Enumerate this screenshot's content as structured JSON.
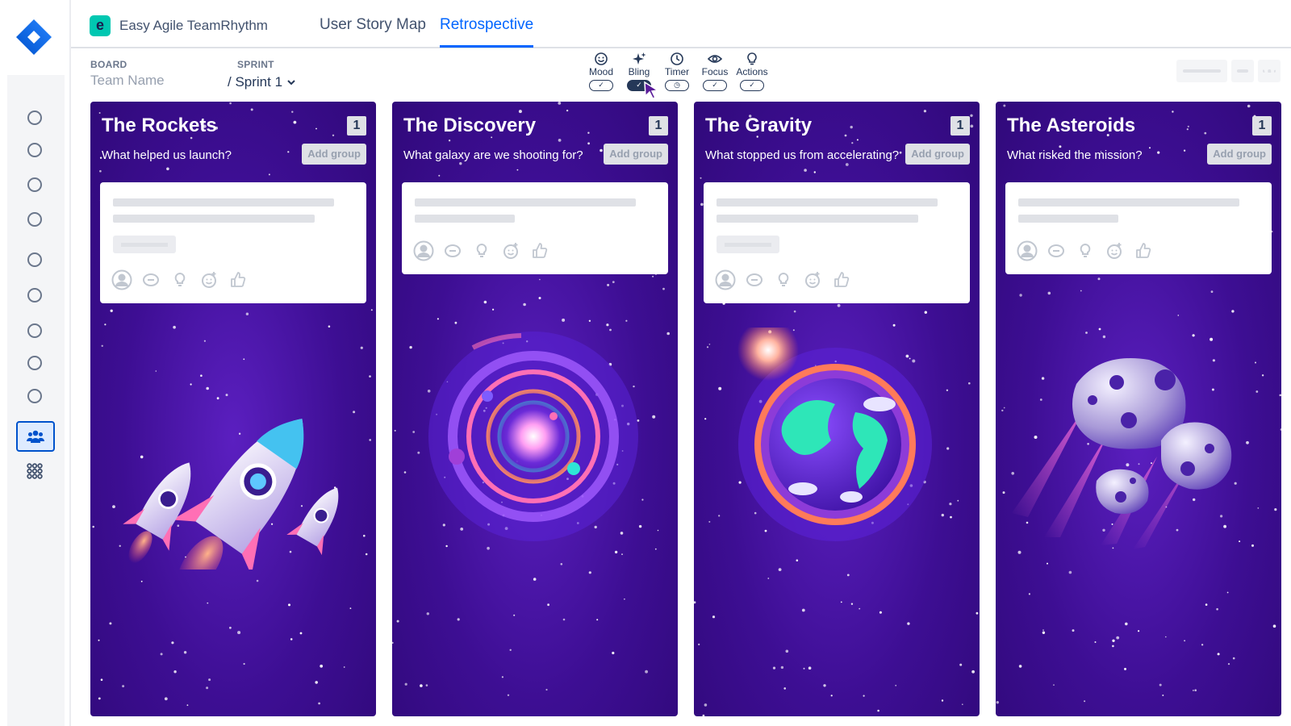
{
  "header": {
    "brand": "Easy Agile TeamRhythm",
    "brand_icon": "e",
    "tabs": [
      {
        "label": "User Story Map",
        "active": false
      },
      {
        "label": "Retrospective",
        "active": true
      }
    ]
  },
  "board": {
    "board_label": "BOARD",
    "board_value": "Team Name",
    "sprint_label": "SPRINT",
    "sprint_value": "/ Sprint 1"
  },
  "tools": [
    {
      "label": "Mood",
      "icon": "smiley-icon",
      "enabled": false
    },
    {
      "label": "Bling",
      "icon": "sparkle-icon",
      "enabled": true
    },
    {
      "label": "Timer",
      "icon": "clock-icon",
      "enabled": false
    },
    {
      "label": "Focus",
      "icon": "eye-icon",
      "enabled": false
    },
    {
      "label": "Actions",
      "icon": "lightbulb-icon",
      "enabled": false
    }
  ],
  "columns": [
    {
      "title": "The Rockets",
      "count": "1",
      "question": "What helped us launch?",
      "add_group": "Add group",
      "illustration": "rockets"
    },
    {
      "title": "The Discovery",
      "count": "1",
      "question": "What galaxy are we shooting for?",
      "add_group": "Add group",
      "illustration": "galaxy"
    },
    {
      "title": "The Gravity",
      "count": "1",
      "question": "What stopped us from accelerating?",
      "add_group": "Add group",
      "illustration": "planet"
    },
    {
      "title": "The Asteroids",
      "count": "1",
      "question": "What risked the mission?",
      "add_group": "Add group",
      "illustration": "asteroids"
    }
  ],
  "colors": {
    "accent": "#0065ff",
    "column_bg": "#3d0e93",
    "brand_teal": "#00c7b1"
  }
}
